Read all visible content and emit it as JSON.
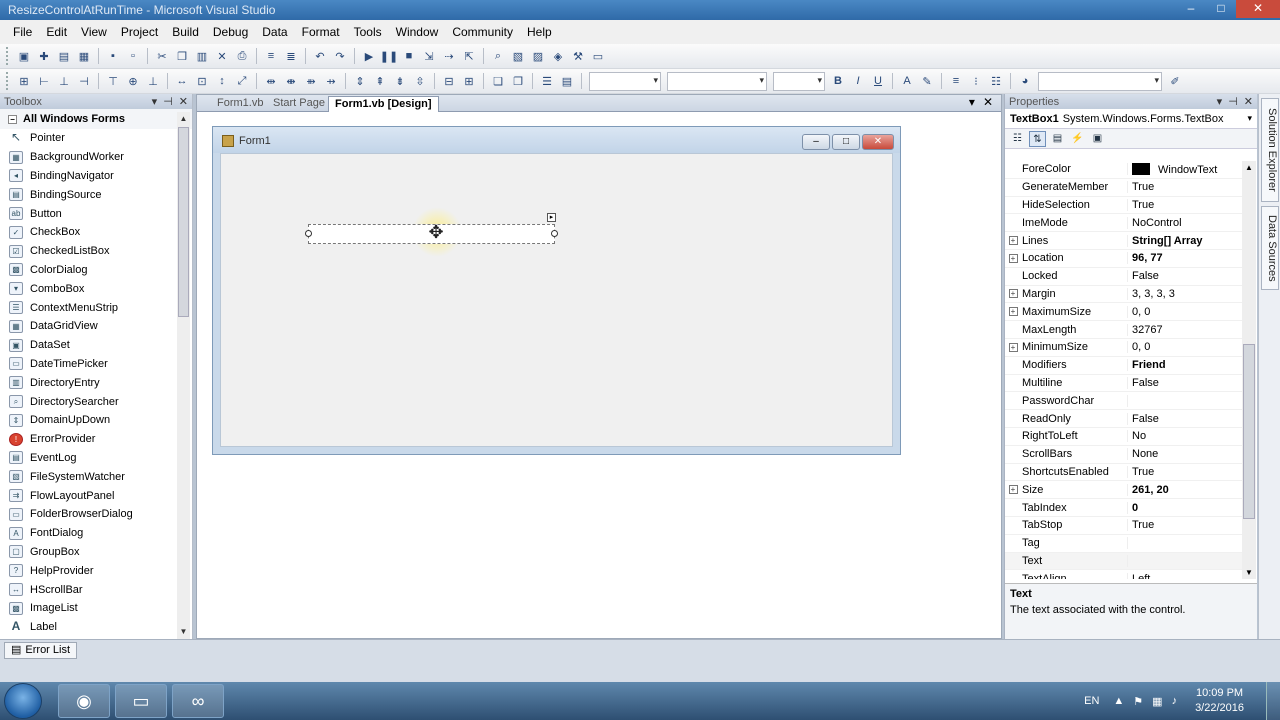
{
  "window": {
    "title": "ResizeControlAtRunTime - Microsoft Visual Studio",
    "btn_minimize": "–",
    "btn_maximize": "□",
    "btn_close": "✕"
  },
  "menu": [
    "File",
    "Edit",
    "View",
    "Project",
    "Build",
    "Debug",
    "Data",
    "Format",
    "Tools",
    "Window",
    "Community",
    "Help"
  ],
  "toolbox": {
    "title": "Toolbox",
    "section": "All Windows Forms",
    "items": [
      "Pointer",
      "BackgroundWorker",
      "BindingNavigator",
      "BindingSource",
      "Button",
      "CheckBox",
      "CheckedListBox",
      "ColorDialog",
      "ComboBox",
      "ContextMenuStrip",
      "DataGridView",
      "DataSet",
      "DateTimePicker",
      "DirectoryEntry",
      "DirectorySearcher",
      "DomainUpDown",
      "ErrorProvider",
      "EventLog",
      "FileSystemWatcher",
      "FlowLayoutPanel",
      "FolderBrowserDialog",
      "FontDialog",
      "GroupBox",
      "HelpProvider",
      "HScrollBar",
      "ImageList",
      "Label"
    ]
  },
  "tabs": [
    "Form1.vb",
    "Start Page",
    "Form1.vb [Design]"
  ],
  "designer": {
    "form_title": "Form1"
  },
  "properties": {
    "title": "Properties",
    "object_name": "TextBox1",
    "object_type": "System.Windows.Forms.TextBox",
    "rows": [
      {
        "name": "ForeColor",
        "value": "WindowText",
        "swatch": "#000000"
      },
      {
        "name": "GenerateMember",
        "value": "True"
      },
      {
        "name": "HideSelection",
        "value": "True"
      },
      {
        "name": "ImeMode",
        "value": "NoControl"
      },
      {
        "name": "Lines",
        "value": "String[] Array",
        "bold": true,
        "expand": true
      },
      {
        "name": "Location",
        "value": "96, 77",
        "bold": true,
        "expand": true
      },
      {
        "name": "Locked",
        "value": "False"
      },
      {
        "name": "Margin",
        "value": "3, 3, 3, 3",
        "expand": true
      },
      {
        "name": "MaximumSize",
        "value": "0, 0",
        "expand": true
      },
      {
        "name": "MaxLength",
        "value": "32767"
      },
      {
        "name": "MinimumSize",
        "value": "0, 0",
        "expand": true
      },
      {
        "name": "Modifiers",
        "value": "Friend",
        "bold": true
      },
      {
        "name": "Multiline",
        "value": "False"
      },
      {
        "name": "PasswordChar",
        "value": ""
      },
      {
        "name": "ReadOnly",
        "value": "False"
      },
      {
        "name": "RightToLeft",
        "value": "No"
      },
      {
        "name": "ScrollBars",
        "value": "None"
      },
      {
        "name": "ShortcutsEnabled",
        "value": "True"
      },
      {
        "name": "Size",
        "value": "261, 20",
        "bold": true,
        "expand": true
      },
      {
        "name": "TabIndex",
        "value": "0",
        "bold": true
      },
      {
        "name": "TabStop",
        "value": "True"
      },
      {
        "name": "Tag",
        "value": ""
      },
      {
        "name": "Text",
        "value": "",
        "selected": true
      },
      {
        "name": "TextAlign",
        "value": "Left"
      }
    ],
    "desc_title": "Text",
    "desc_text": "The text associated with the control."
  },
  "side_tabs": [
    "Solution Explorer",
    "Data Sources"
  ],
  "error_list": "Error List",
  "taskbar": {
    "lang": "EN",
    "time": "10:09 PM",
    "date": "3/22/2016"
  }
}
